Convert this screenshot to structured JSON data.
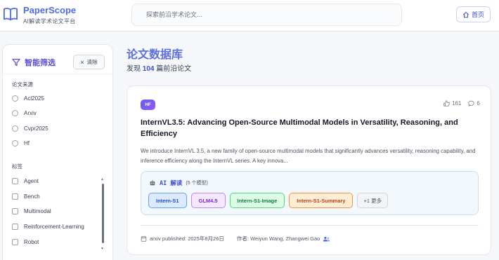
{
  "header": {
    "brand": "PaperScope",
    "brand_sub": "AI解读学术论文平台",
    "search_placeholder": "探索前沿学术论文...",
    "home_label": "首页"
  },
  "sidebar": {
    "title": "智能筛选",
    "clear_label": "清除",
    "source_title": "论文来源",
    "sources": [
      "Acl2025",
      "Arxiv",
      "Cvpr2025",
      "Hf"
    ],
    "tags_title": "标签",
    "tags": [
      "Agent",
      "Bench",
      "Multimodal",
      "Reinforcement-Learning",
      "Robot"
    ]
  },
  "main": {
    "title": "论文数据库",
    "count_prefix": "发现",
    "count": "104",
    "count_suffix": "篇前沿论文"
  },
  "paper": {
    "badge": "HF",
    "likes": "161",
    "comments": "6",
    "title": "InternVL3.5: Advancing Open-Source Multimodal Models in Versatility, Reasoning, and Efficiency",
    "abstract": "We introduce InternVL 3.5, a new family of open-source multimodal models that significantly advances versatility, reasoning capability, and inference efficiency along the InternVL series. A key innova...",
    "ai_label": "AI 解读",
    "ai_sub": "(5 个模型)",
    "models": [
      "Intern-S1",
      "GLM4.5",
      "Intern-S1-Image",
      "Intern-S1-Summary"
    ],
    "more_label": "+1 更多",
    "published": "arxiv published: 2025年8月26日",
    "authors": "作者: Weiyun Wang, Zhangwei Gao"
  },
  "colors": {
    "accent": "#4f6ae8",
    "title_gradient": "#5b6fe0",
    "filter_accent": "#5b4cd6"
  }
}
